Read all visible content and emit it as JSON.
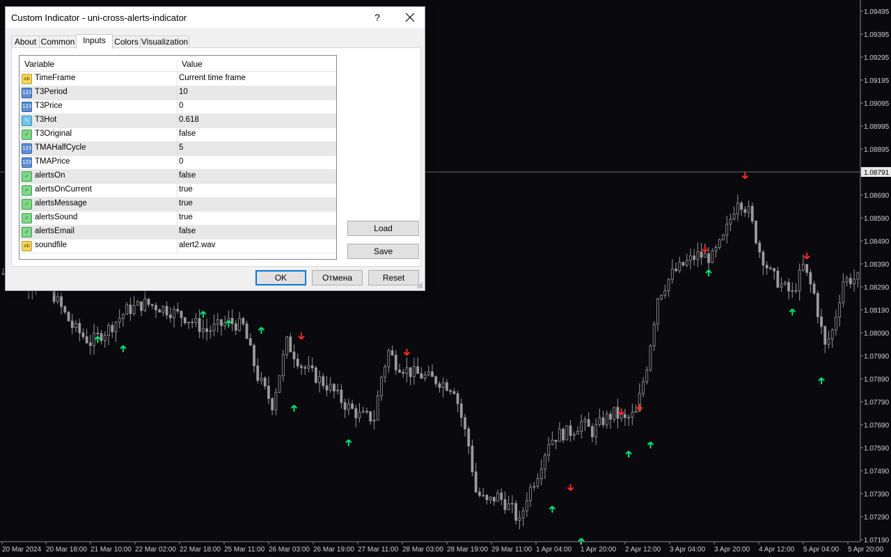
{
  "dialog": {
    "title": "Custom Indicator - uni-cross-alerts-indicator",
    "help_label": "?",
    "tabs": [
      {
        "label": "About"
      },
      {
        "label": "Common"
      },
      {
        "label": "Inputs",
        "active": true
      },
      {
        "label": "Colors"
      },
      {
        "label": "Visualization"
      }
    ],
    "columns": {
      "variable": "Variable",
      "value": "Value"
    },
    "inputs": [
      {
        "name": "TimeFrame",
        "value": "Current time frame",
        "icon": "string-type-icon",
        "icon_text": "ab"
      },
      {
        "name": "T3Period",
        "value": "10",
        "icon": "integer-type-icon",
        "icon_text": "123"
      },
      {
        "name": "T3Price",
        "value": "0",
        "icon": "integer-type-icon",
        "icon_text": "123"
      },
      {
        "name": "T3Hot",
        "value": "0.618",
        "icon": "double-type-icon",
        "icon_text": "½"
      },
      {
        "name": "T3Original",
        "value": "false",
        "icon": "bool-type-icon",
        "icon_text": "✓"
      },
      {
        "name": "TMAHalfCycle",
        "value": "5",
        "icon": "integer-type-icon",
        "icon_text": "123"
      },
      {
        "name": "TMAPrice",
        "value": "0",
        "icon": "integer-type-icon",
        "icon_text": "123"
      },
      {
        "name": "alertsOn",
        "value": "false",
        "icon": "bool-type-icon",
        "icon_text": "✓"
      },
      {
        "name": "alertsOnCurrent",
        "value": "true",
        "icon": "bool-type-icon",
        "icon_text": "✓"
      },
      {
        "name": "alertsMessage",
        "value": "true",
        "icon": "bool-type-icon",
        "icon_text": "✓"
      },
      {
        "name": "alertsSound",
        "value": "true",
        "icon": "bool-type-icon",
        "icon_text": "✓"
      },
      {
        "name": "alertsEmail",
        "value": "false",
        "icon": "bool-type-icon",
        "icon_text": "✓"
      },
      {
        "name": "soundfile",
        "value": "alert2.wav",
        "icon": "string-type-icon",
        "icon_text": "ab"
      }
    ],
    "buttons": {
      "load": "Load",
      "save": "Save",
      "ok": "OK",
      "cancel": "Отмена",
      "reset": "Reset"
    }
  },
  "price_axis": {
    "labels": [
      "1.09495",
      "1.09395",
      "1.09295",
      "1.09195",
      "1.09095",
      "1.08995",
      "1.08895",
      "1.08791",
      "1.08690",
      "1.08590",
      "1.08490",
      "1.08390",
      "1.08290",
      "1.08190",
      "1.08090",
      "1.07990",
      "1.07890",
      "1.07790",
      "1.07690",
      "1.07590",
      "1.07490",
      "1.07390",
      "1.07290",
      "1.07190"
    ],
    "current_price": "1.08791"
  },
  "time_axis": {
    "labels": [
      "20 Mar 2024",
      "20 Mar 18:00",
      "21 Mar 10:00",
      "22 Mar 02:00",
      "22 Mar 18:00",
      "25 Mar 11:00",
      "26 Mar 03:00",
      "26 Mar 19:00",
      "27 Mar 11:00",
      "28 Mar 03:00",
      "28 Mar 19:00",
      "29 Mar 11:00",
      "1 Apr 04:00",
      "1 Apr 20:00",
      "2 Apr 12:00",
      "3 Apr 04:00",
      "3 Apr 20:00",
      "4 Apr 12:00",
      "5 Apr 04:00",
      "5 Apr 20:00"
    ]
  },
  "colors": {
    "background": "#0a0a0e",
    "candle": "#9a9a9a",
    "up_arrow": "#00e676",
    "down_arrow": "#ff2a2a",
    "dialog_bg": "#f0f0f0",
    "accent": "#0078d7"
  },
  "chart_data": {
    "type": "candlestick",
    "y_range": [
      1.0719,
      1.09495
    ],
    "close_path": [
      [
        0,
        1.0835
      ],
      [
        7,
        1.0831
      ],
      [
        13,
        1.0828
      ],
      [
        19,
        1.0812
      ],
      [
        24,
        1.0805
      ],
      [
        29,
        1.0811
      ],
      [
        34,
        1.0819
      ],
      [
        39,
        1.0822
      ],
      [
        44,
        1.082
      ],
      [
        50,
        1.0816
      ],
      [
        56,
        1.081
      ],
      [
        62,
        1.0814
      ],
      [
        66,
        1.0812
      ],
      [
        70,
        1.079
      ],
      [
        74,
        1.0778
      ],
      [
        78,
        1.0805
      ],
      [
        82,
        1.0795
      ],
      [
        86,
        1.079
      ],
      [
        90,
        1.0785
      ],
      [
        94,
        1.0778
      ],
      [
        98,
        1.0773
      ],
      [
        102,
        1.0772
      ],
      [
        104,
        1.079
      ],
      [
        106,
        1.0801
      ],
      [
        108,
        1.0796
      ],
      [
        112,
        1.0792
      ],
      [
        116,
        1.079
      ],
      [
        120,
        1.0788
      ],
      [
        124,
        1.0785
      ],
      [
        128,
        1.076
      ],
      [
        130,
        1.074
      ],
      [
        133,
        1.0735
      ],
      [
        136,
        1.0738
      ],
      [
        140,
        1.0732
      ],
      [
        142,
        1.0726
      ],
      [
        144,
        1.0738
      ],
      [
        147,
        1.0748
      ],
      [
        150,
        1.0762
      ],
      [
        153,
        1.0765
      ],
      [
        156,
        1.0766
      ],
      [
        159,
        1.077
      ],
      [
        162,
        1.0766
      ],
      [
        165,
        1.0771
      ],
      [
        168,
        1.0774
      ],
      [
        171,
        1.0771
      ],
      [
        174,
        1.0774
      ],
      [
        177,
        1.0795
      ],
      [
        180,
        1.0825
      ],
      [
        184,
        1.0835
      ],
      [
        188,
        1.084
      ],
      [
        191,
        1.0843
      ],
      [
        195,
        1.0842
      ],
      [
        198,
        1.085
      ],
      [
        202,
        1.0868
      ],
      [
        205,
        1.0862
      ],
      [
        208,
        1.0845
      ],
      [
        211,
        1.0835
      ],
      [
        214,
        1.083
      ],
      [
        217,
        1.0826
      ],
      [
        220,
        1.0838
      ],
      [
        223,
        1.0826
      ],
      [
        226,
        1.0803
      ],
      [
        228,
        1.081
      ],
      [
        231,
        1.0832
      ],
      [
        235,
        1.0833
      ]
    ],
    "up_arrows": [
      [
        26,
        1.0806
      ],
      [
        33,
        1.0802
      ],
      [
        55,
        1.0817
      ],
      [
        62,
        1.0813
      ],
      [
        71,
        1.081
      ],
      [
        80,
        1.0776
      ],
      [
        95,
        1.0761
      ],
      [
        151,
        1.0732
      ],
      [
        159,
        1.0718
      ],
      [
        172,
        1.0756
      ],
      [
        178,
        1.076
      ],
      [
        194,
        1.0835
      ],
      [
        217,
        1.0818
      ],
      [
        225,
        1.0788
      ]
    ],
    "down_arrows": [
      [
        82,
        1.0808
      ],
      [
        111,
        1.0801
      ],
      [
        156,
        1.0742
      ],
      [
        170,
        1.0775
      ],
      [
        175,
        1.0777
      ],
      [
        193,
        1.0846
      ],
      [
        204,
        1.0878
      ],
      [
        221,
        1.0843
      ]
    ],
    "total_bars": 236
  }
}
